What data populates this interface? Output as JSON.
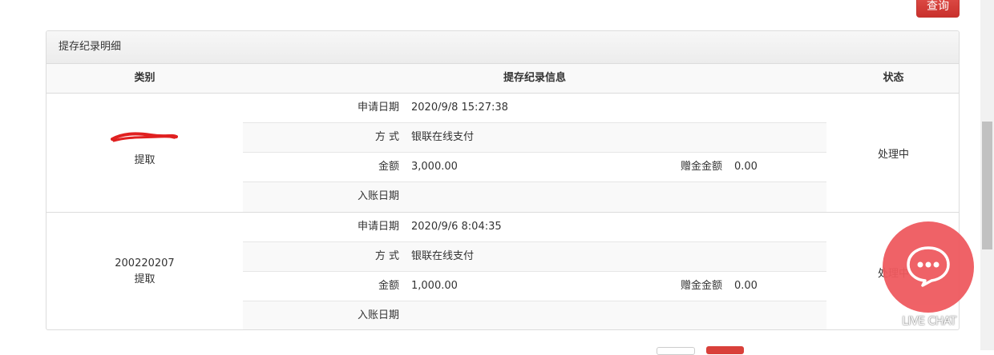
{
  "toolbar": {
    "query_label": "查询"
  },
  "panel": {
    "title": "提存纪录明细",
    "headers": {
      "type": "类别",
      "info": "提存纪录信息",
      "status": "状态"
    },
    "labels": {
      "apply_date": "申请日期",
      "method": "方 式",
      "amount": "金额",
      "bonus": "赠金金额",
      "post_date": "入账日期"
    },
    "records": [
      {
        "id": "",
        "type": "提取",
        "apply_date": "2020/9/8 15:27:38",
        "method": "银联在线支付",
        "amount": "3,000.00",
        "bonus": "0.00",
        "post_date": "",
        "status": "处理中"
      },
      {
        "id": "200220207",
        "type": "提取",
        "apply_date": "2020/9/6 8:04:35",
        "method": "银联在线支付",
        "amount": "1,000.00",
        "bonus": "0.00",
        "post_date": "",
        "status": "处理中"
      }
    ]
  },
  "chat": {
    "label": "LIVE CHAT",
    "icon": "chat-bubble-icon"
  },
  "colors": {
    "accent": "#d9403a",
    "chat": "#ef5a5f"
  }
}
